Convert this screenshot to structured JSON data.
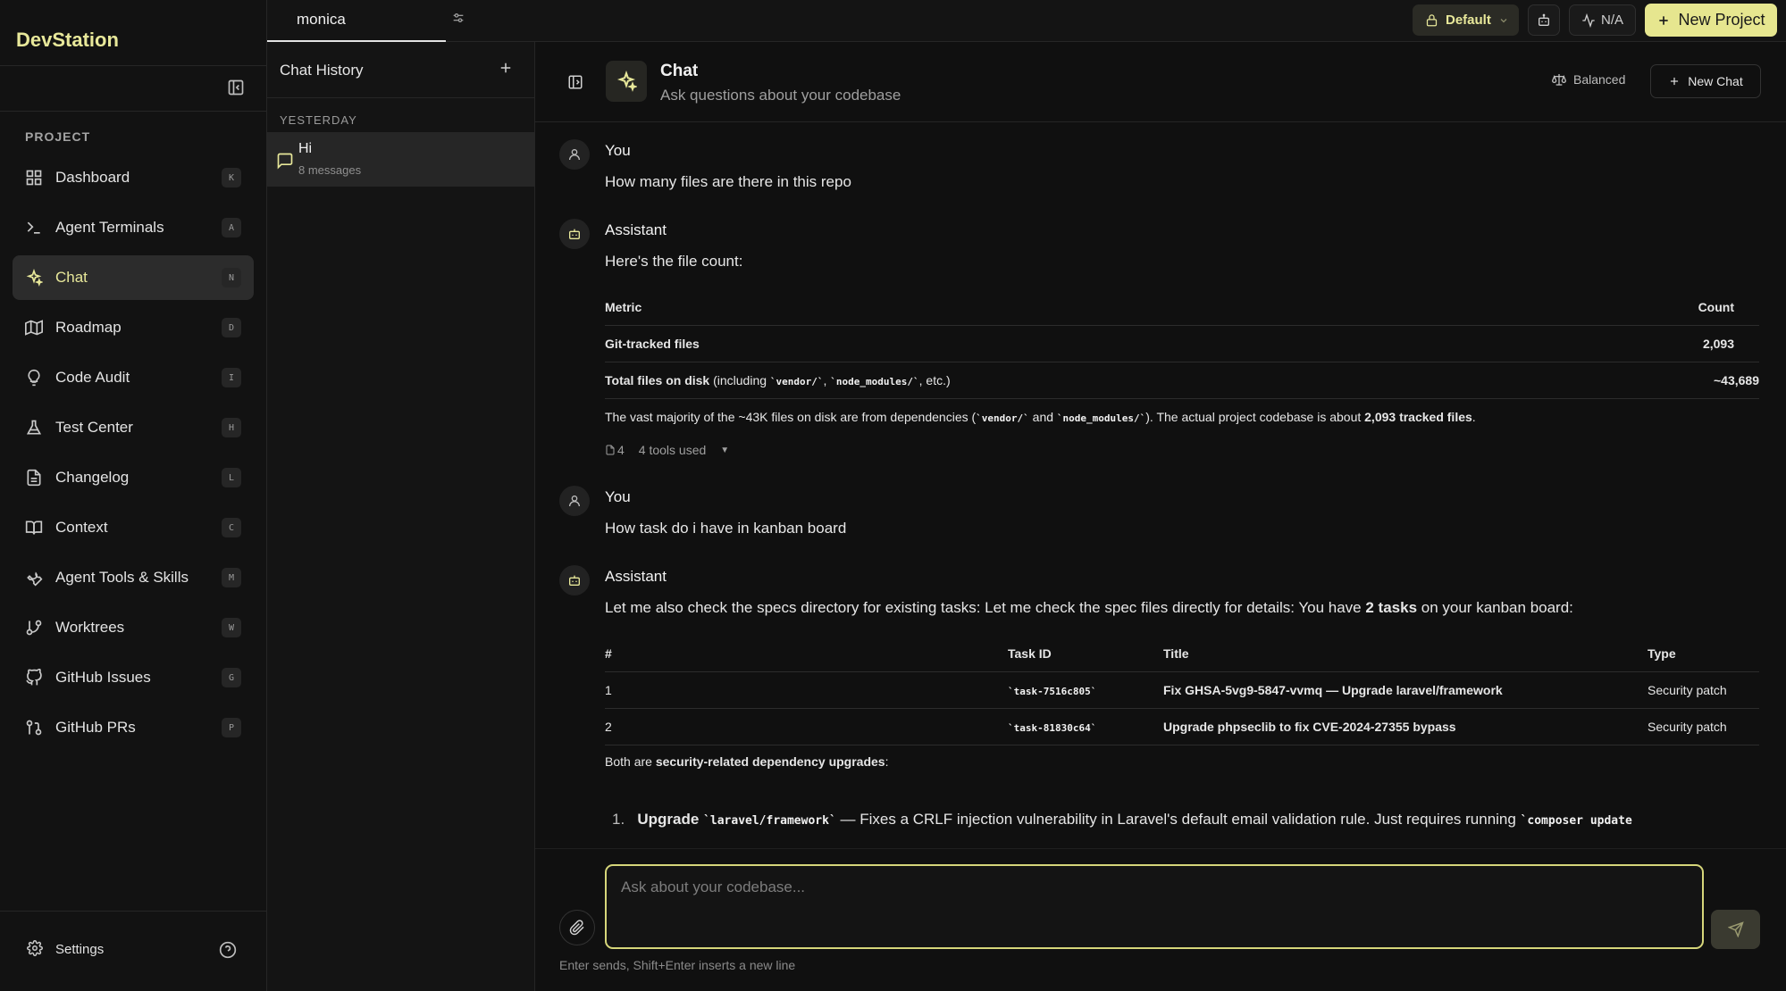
{
  "app": {
    "name": "DevStation"
  },
  "sidebar": {
    "section_label": "PROJECT",
    "items": [
      {
        "label": "Dashboard",
        "key": "K",
        "icon": "dashboard-icon"
      },
      {
        "label": "Agent Terminals",
        "key": "A",
        "icon": "terminal-icon"
      },
      {
        "label": "Chat",
        "key": "N",
        "icon": "sparkles-icon",
        "active": true
      },
      {
        "label": "Roadmap",
        "key": "D",
        "icon": "map-icon"
      },
      {
        "label": "Code Audit",
        "key": "I",
        "icon": "lightbulb-icon"
      },
      {
        "label": "Test Center",
        "key": "H",
        "icon": "flask-icon"
      },
      {
        "label": "Changelog",
        "key": "L",
        "icon": "file-text-icon"
      },
      {
        "label": "Context",
        "key": "C",
        "icon": "book-icon"
      },
      {
        "label": "Agent Tools & Skills",
        "key": "M",
        "icon": "wrench-icon"
      },
      {
        "label": "Worktrees",
        "key": "W",
        "icon": "git-branch-icon"
      },
      {
        "label": "GitHub Issues",
        "key": "G",
        "icon": "github-icon"
      },
      {
        "label": "GitHub PRs",
        "key": "P",
        "icon": "git-pull-request-icon"
      }
    ],
    "settings_label": "Settings"
  },
  "topbar": {
    "project_tab": "monica",
    "profile": "Default",
    "usage": "N/A",
    "new_project": "New Project"
  },
  "history": {
    "title": "Chat History",
    "group": "YESTERDAY",
    "item": {
      "title": "Hi",
      "subtitle": "8 messages"
    }
  },
  "chat": {
    "title": "Chat",
    "subtitle": "Ask questions about your codebase",
    "mode": "Balanced",
    "new_chat": "New Chat",
    "messages": [
      {
        "author": "You",
        "text": "How many files are there in this repo"
      },
      {
        "author": "Assistant",
        "text": "Here's the file count:"
      },
      {
        "author": "You",
        "text": "How task do i have in kanban board"
      },
      {
        "author": "Assistant",
        "text_before": "Let me also check the specs directory for existing tasks: Let me check the spec files directly for details: You have ",
        "text_bold": "2 tasks",
        "text_after": " on your kanban board:"
      }
    ],
    "file_table": {
      "headers": [
        "Metric",
        "Count"
      ],
      "rows": [
        {
          "metric": "Git-tracked files",
          "count": "2,093"
        },
        {
          "metric": "Total files on disk",
          "note_pre": " (including ",
          "code1": "`vendor/`",
          "sep": ", ",
          "code2": "`node_modules/`",
          "note_post": ", etc.)",
          "count": "~43,689"
        }
      ]
    },
    "file_note": {
      "pre": "The vast majority of the ~43K files on disk are from dependencies (",
      "code1": "`vendor/`",
      "mid": " and ",
      "code2": "`node_modules/`",
      "post": "). The actual project codebase is about ",
      "bold": "2,093 tracked files",
      "end": "."
    },
    "tools": {
      "count": "4",
      "label": "4 tools used"
    },
    "task_table": {
      "headers": [
        "#",
        "Task ID",
        "Title",
        "Type"
      ],
      "rows": [
        {
          "num": "1",
          "id": "`task-7516c805`",
          "title": "Fix GHSA-5vg9-5847-vvmq — Upgrade laravel/framework",
          "type": "Security patch"
        },
        {
          "num": "2",
          "id": "`task-81830c64`",
          "title": "Upgrade phpseclib to fix CVE-2024-27355 bypass",
          "type": "Security patch"
        }
      ]
    },
    "summary": {
      "pre": "Both are ",
      "bold": "security-related dependency upgrades",
      "post": ":"
    },
    "list_item": {
      "num": "1.",
      "bold": "Upgrade",
      "code1": "`laravel/framework`",
      "text": " — Fixes a CRLF injection vulnerability in Laravel's default email validation rule. Just requires running ",
      "code2": "`composer update"
    },
    "input_placeholder": "Ask about your codebase...",
    "input_hint": "Enter sends, Shift+Enter inserts a new line"
  }
}
